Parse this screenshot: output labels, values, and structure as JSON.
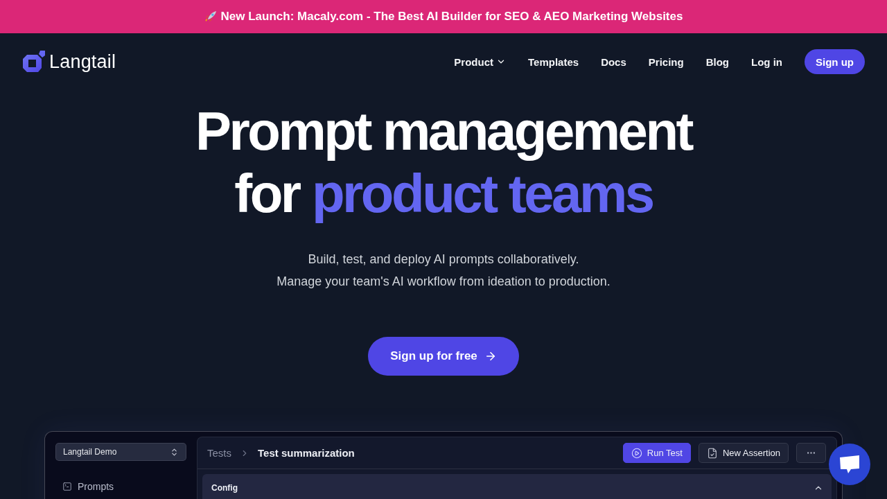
{
  "announcement": {
    "text": "New Launch: Macaly.com - The Best AI Builder for SEO & AEO Marketing Websites"
  },
  "nav": {
    "logo": "Langtail",
    "links": [
      {
        "label": "Product",
        "kind": "dropdown"
      },
      {
        "label": "Templates",
        "kind": "link"
      },
      {
        "label": "Docs",
        "kind": "link"
      },
      {
        "label": "Pricing",
        "kind": "link"
      },
      {
        "label": "Blog",
        "kind": "link"
      },
      {
        "label": "Log in",
        "kind": "link"
      },
      {
        "label": "Sign up",
        "kind": "button"
      }
    ]
  },
  "hero": {
    "title_lines": [
      {
        "parts": [
          {
            "text": "Prompt management",
            "accent": false
          }
        ]
      },
      {
        "parts": [
          {
            "text": "for",
            "accent": false
          },
          {
            "text": "product teams",
            "accent": true
          }
        ]
      }
    ],
    "subtitle_lines": [
      "Build, test, and deploy AI prompts collaboratively.",
      "Manage your team's AI workflow from ideation to production."
    ],
    "cta": "Sign up for free"
  },
  "app_preview": {
    "workspace": "Langtail Demo",
    "sidebar_items": [
      "Prompts"
    ],
    "breadcrumb": [
      "Tests",
      "Test summarization"
    ],
    "actions": [
      {
        "kind": "primary",
        "label": "Run Test"
      },
      {
        "kind": "secondary",
        "label": "New Assertion"
      },
      {
        "kind": "more"
      }
    ],
    "panel": {
      "title": "Config",
      "expanded": true
    }
  }
}
